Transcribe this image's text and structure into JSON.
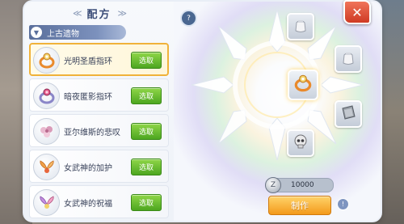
{
  "panel": {
    "title": "配方",
    "title_deco_left": "≪",
    "title_deco_right": "≫"
  },
  "category": {
    "label": "上古遗物",
    "arrow": "▼"
  },
  "recipes": [
    {
      "name": "光明圣盾指环",
      "button": "选取",
      "icon": "ring-icon",
      "selected": true
    },
    {
      "name": "暗夜匿影指环",
      "button": "选取",
      "icon": "ring-icon",
      "selected": false
    },
    {
      "name": "亚尔维斯的悲叹",
      "button": "选取",
      "icon": "flower-icon",
      "selected": false
    },
    {
      "name": "女武神的加护",
      "button": "选取",
      "icon": "wing-icon",
      "selected": false
    },
    {
      "name": "女武神的祝福",
      "button": "选取",
      "icon": "wing-icon",
      "selected": false
    }
  ],
  "crafting": {
    "center_icon": "ring-icon",
    "ingredients": [
      "bag-icon",
      "bag-icon",
      "shield-icon",
      "skull-icon"
    ],
    "cost": "10000",
    "coin_icon": "zeny-coin-icon",
    "craft_button": "制作"
  },
  "icons": {
    "help": "?",
    "close": "✕",
    "info": "!"
  },
  "colors": {
    "title": "#3b4d78",
    "category_bg": "#5a6f9c",
    "pick_button": "#4da620",
    "selected_border": "#f0b23a",
    "craft_button": "#f39a1b",
    "close_button": "#cf3a24"
  }
}
